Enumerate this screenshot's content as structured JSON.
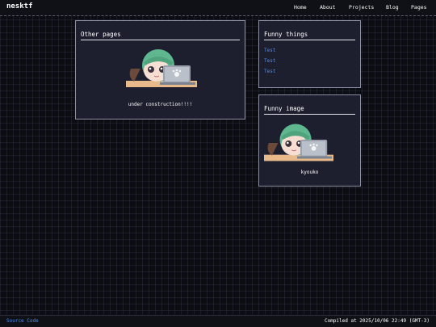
{
  "header": {
    "brand": "nesktf",
    "nav": [
      "Home",
      "About",
      "Projects",
      "Blog",
      "Pages"
    ]
  },
  "main": {
    "other_pages": {
      "title": "Other pages",
      "caption": "under construction!!!!"
    },
    "funny_things": {
      "title": "Funny things",
      "links": [
        "Test",
        "Test",
        "Test"
      ]
    },
    "funny_image": {
      "title": "Funny image",
      "caption": "kyouko"
    }
  },
  "footer": {
    "source_link": "Source Code",
    "compiled": "Compiled at 2025/10/06 22:49 (GMT-3)"
  },
  "colors": {
    "accent": "#4d8ef0",
    "card_bg": "#1d1f2e",
    "page_bg": "#0b0d12"
  }
}
